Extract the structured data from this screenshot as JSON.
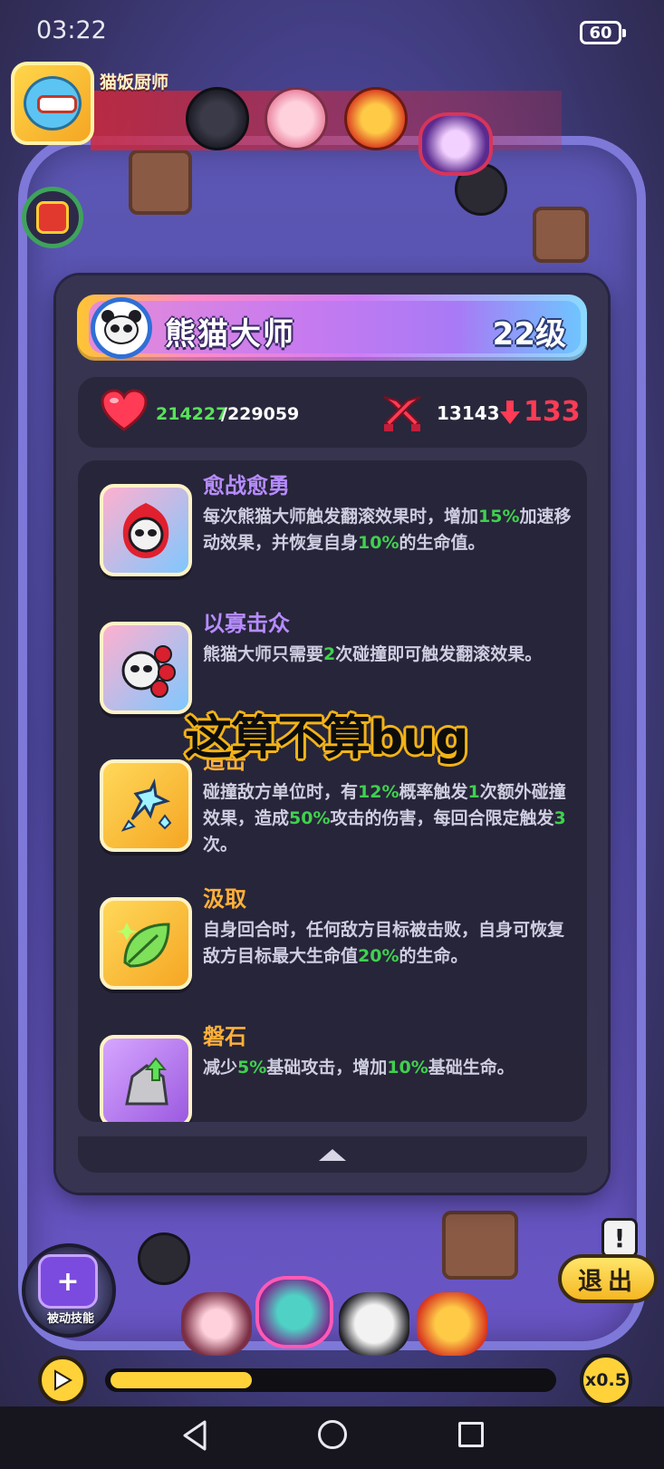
{
  "status": {
    "time": "03:22",
    "battery": "60"
  },
  "player": {
    "name": "猫饭厨师"
  },
  "hero": {
    "name": "熊猫大师",
    "level": "22级"
  },
  "stats": {
    "hp_current": "214227",
    "hp_max": "/229059",
    "attack": "13143",
    "attack_drop": "133"
  },
  "skills": [
    {
      "name": "愈战愈勇",
      "color": "#b68cff",
      "desc_parts": [
        "每次熊猫大师触发翻滚效果时，增加",
        "15%",
        "加速移动效果，并恢复自身",
        "10%",
        "的生命值。"
      ]
    },
    {
      "name": "以寡击众",
      "color": "#b68cff",
      "desc_parts": [
        "熊猫大师只需要",
        "2",
        "次碰撞即可触发翻滚效果。"
      ]
    },
    {
      "name": "追击",
      "color": "#ffb03a",
      "desc_parts": [
        "碰撞敌方单位时，有",
        "12%",
        "概率触发",
        "1",
        "次额外碰撞效果，造成",
        "50%",
        "攻击的伤害，每回合限定触发",
        "3",
        "次。"
      ]
    },
    {
      "name": "汲取",
      "color": "#ffb03a",
      "desc_parts": [
        "自身回合时，任何敌方目标被击败，自身可恢复敌方目标最大生命值",
        "20%",
        "的生命。"
      ]
    },
    {
      "name": "磐石",
      "color": "#ffb03a",
      "desc_parts": [
        "减少",
        "5%",
        "基础攻击，增加",
        "10%",
        "基础生命。"
      ]
    }
  ],
  "overlay_caption": "这算不算bug",
  "controls": {
    "passive_label": "被动技能",
    "exit_label": "退出",
    "speed_label": "x0.5",
    "progress": 0.32
  }
}
